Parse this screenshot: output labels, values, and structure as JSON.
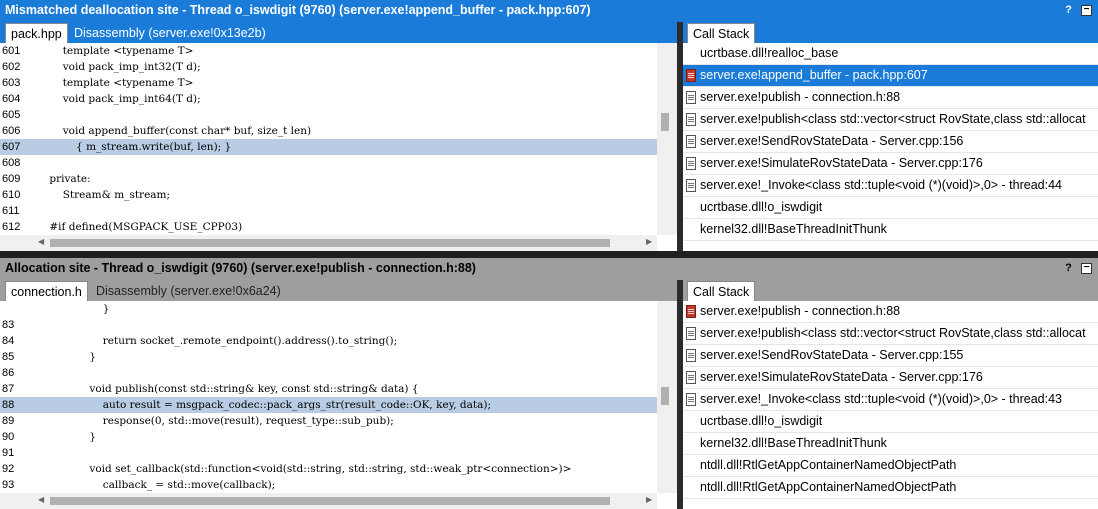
{
  "top": {
    "title": "Mismatched deallocation site - Thread o_iswdigit (9760) (server.exe!append_buffer - pack.hpp:607)",
    "help_glyph": "?",
    "min_glyph": "−",
    "tabs": [
      "pack.hpp",
      "Disassembly (server.exe!0x13e2b)"
    ],
    "code": [
      {
        "n": "601",
        "t": "        template <typename T>"
      },
      {
        "n": "602",
        "t": "        void pack_imp_int32(T d);"
      },
      {
        "n": "603",
        "t": "        template <typename T>"
      },
      {
        "n": "604",
        "t": "        void pack_imp_int64(T d);"
      },
      {
        "n": "605",
        "t": ""
      },
      {
        "n": "606",
        "t": "        void append_buffer(const char* buf, size_t len)"
      },
      {
        "n": "607",
        "t": "            { m_stream.write(buf, len); }"
      },
      {
        "n": "608",
        "t": ""
      },
      {
        "n": "609",
        "t": "    private:"
      },
      {
        "n": "610",
        "t": "        Stream& m_stream;"
      },
      {
        "n": "611",
        "t": ""
      },
      {
        "n": "612",
        "t": "    #if defined(MSGPACK_USE_CPP03)"
      }
    ],
    "highlight": "607",
    "callstack_tab": "Call Stack",
    "frames": [
      {
        "icon": "",
        "label": "ucrtbase.dll!realloc_base"
      },
      {
        "icon": "current-frame-icon",
        "label": "server.exe!append_buffer - pack.hpp:607"
      },
      {
        "icon": "source-file-icon",
        "label": "server.exe!publish - connection.h:88"
      },
      {
        "icon": "source-file-icon",
        "label": "server.exe!publish<class std::vector<struct RovState,class std::allocat"
      },
      {
        "icon": "source-file-icon",
        "label": "server.exe!SendRovStateData - Server.cpp:156"
      },
      {
        "icon": "source-file-icon",
        "label": "server.exe!SimulateRovStateData - Server.cpp:176"
      },
      {
        "icon": "source-file-icon",
        "label": "server.exe!_Invoke<class std::tuple<void (*)(void)>,0> - thread:44"
      },
      {
        "icon": "",
        "label": "ucrtbase.dll!o_iswdigit"
      },
      {
        "icon": "",
        "label": "kernel32.dll!BaseThreadInitThunk"
      }
    ]
  },
  "bottom": {
    "title": "Allocation site - Thread o_iswdigit (9760) (server.exe!publish - connection.h:88)",
    "help_glyph": "?",
    "min_glyph": "−",
    "tabs": [
      "connection.h",
      "Disassembly (server.exe!0x6a24)"
    ],
    "code": [
      {
        "n": "",
        "t": "                    }"
      },
      {
        "n": "83",
        "t": ""
      },
      {
        "n": "84",
        "t": "                    return socket_.remote_endpoint().address().to_string();"
      },
      {
        "n": "85",
        "t": "                }"
      },
      {
        "n": "86",
        "t": ""
      },
      {
        "n": "87",
        "t": "                void publish(const std::string& key, const std::string& data) {"
      },
      {
        "n": "88",
        "t": "                    auto result = msgpack_codec::pack_args_str(result_code::OK, key, data);"
      },
      {
        "n": "89",
        "t": "                    response(0, std::move(result), request_type::sub_pub);"
      },
      {
        "n": "90",
        "t": "                }"
      },
      {
        "n": "91",
        "t": ""
      },
      {
        "n": "92",
        "t": "                void set_callback(std::function<void(std::string, std::string, std::weak_ptr<connection>)>"
      },
      {
        "n": "93",
        "t": "                    callback_ = std::move(callback);"
      }
    ],
    "highlight": "88",
    "callstack_tab": "Call Stack",
    "frames": [
      {
        "icon": "current-frame-icon",
        "label": "server.exe!publish - connection.h:88"
      },
      {
        "icon": "source-file-icon",
        "label": "server.exe!publish<class std::vector<struct RovState,class std::allocat"
      },
      {
        "icon": "source-file-icon",
        "label": "server.exe!SendRovStateData - Server.cpp:155"
      },
      {
        "icon": "source-file-icon",
        "label": "server.exe!SimulateRovStateData - Server.cpp:176"
      },
      {
        "icon": "source-file-icon",
        "label": "server.exe!_Invoke<class std::tuple<void (*)(void)>,0> - thread:43"
      },
      {
        "icon": "",
        "label": "ucrtbase.dll!o_iswdigit"
      },
      {
        "icon": "",
        "label": "kernel32.dll!BaseThreadInitThunk"
      },
      {
        "icon": "",
        "label": "ntdll.dll!RtlGetAppContainerNamedObjectPath"
      },
      {
        "icon": "",
        "label": "ntdll.dll!RtlGetAppContainerNamedObjectPath"
      }
    ]
  }
}
